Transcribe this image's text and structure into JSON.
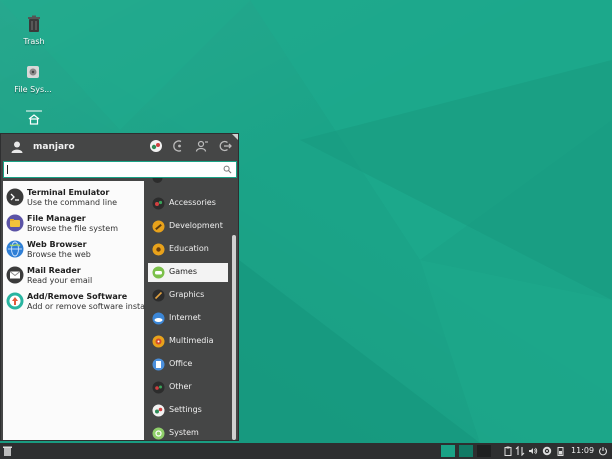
{
  "desktop": {
    "icons": [
      {
        "label": "Trash",
        "icon": "trash-icon"
      },
      {
        "label": "File Sys...",
        "icon": "drive-icon"
      },
      {
        "label": "",
        "icon": "home-icon"
      }
    ]
  },
  "menu": {
    "username": "manjaro",
    "search": {
      "value": "",
      "placeholder": ""
    },
    "favorites": [
      {
        "name": "Terminal Emulator",
        "desc": "Use the command line",
        "icon": "terminal-icon"
      },
      {
        "name": "File Manager",
        "desc": "Browse the file system",
        "icon": "folder-icon"
      },
      {
        "name": "Web Browser",
        "desc": "Browse the web",
        "icon": "globe-icon"
      },
      {
        "name": "Mail Reader",
        "desc": "Read your email",
        "icon": "mail-icon"
      },
      {
        "name": "Add/Remove Software",
        "desc": "Add or remove software insta...",
        "icon": "package-icon"
      }
    ],
    "categories": [
      {
        "label": "Accessories",
        "icon": "accessories-icon"
      },
      {
        "label": "Development",
        "icon": "development-icon"
      },
      {
        "label": "Education",
        "icon": "education-icon"
      },
      {
        "label": "Games",
        "icon": "games-icon"
      },
      {
        "label": "Graphics",
        "icon": "graphics-icon"
      },
      {
        "label": "Internet",
        "icon": "internet-icon"
      },
      {
        "label": "Multimedia",
        "icon": "multimedia-icon"
      },
      {
        "label": "Office",
        "icon": "office-icon"
      },
      {
        "label": "Other",
        "icon": "other-icon"
      },
      {
        "label": "Settings",
        "icon": "settings-icon"
      },
      {
        "label": "System",
        "icon": "system-icon"
      }
    ],
    "active_category": "Games"
  },
  "taskbar": {
    "clock": "11:09"
  },
  "colors": {
    "accent": "#1aa386",
    "panel": "#454646",
    "taskbar": "#2e2f30"
  }
}
